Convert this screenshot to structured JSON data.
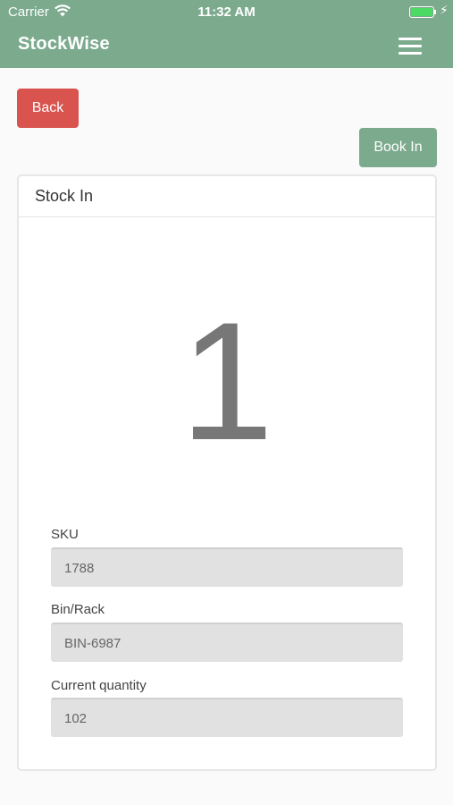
{
  "status_bar": {
    "carrier": "Carrier",
    "time": "11:32 AM",
    "battery_fill_fraction": 1.0
  },
  "header": {
    "title": "StockWise",
    "menu_icon": "hamburger-menu-icon"
  },
  "actions": {
    "back_label": "Back",
    "book_in_label": "Book In"
  },
  "card": {
    "title": "Stock In",
    "count": "1",
    "fields": [
      {
        "label": "SKU",
        "value": "1788"
      },
      {
        "label": "Bin/Rack",
        "value": "BIN-6987"
      },
      {
        "label": "Current quantity",
        "value": "102"
      }
    ]
  },
  "colors": {
    "header_bg": "#7baa8d",
    "back_button": "#d9534f",
    "book_in_button": "#7baa8d",
    "battery": "#4cd964"
  }
}
